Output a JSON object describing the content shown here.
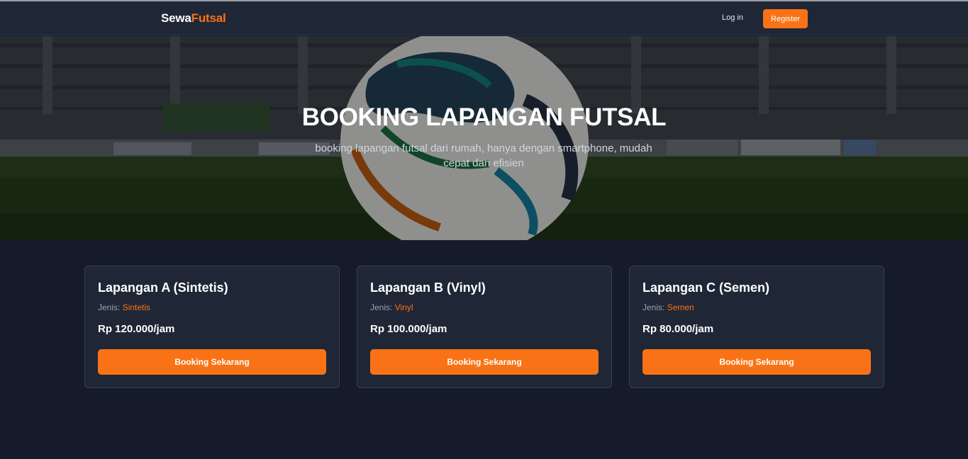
{
  "navbar": {
    "brand_part1": "Sewa",
    "brand_part2": "Futsal",
    "login_label": "Log in",
    "register_label": "Register"
  },
  "hero": {
    "title": "BOOKING LAPANGAN FUTSAL",
    "subtitle": "booking lapangan futsal dari rumah, hanya dengan smartphone, mudah cepat dan efisien"
  },
  "fields": [
    {
      "name": "Lapangan A (Sintetis)",
      "type_label": "Jenis:",
      "type_value": "Sintetis",
      "price": "Rp 120.000/jam",
      "button_label": "Booking Sekarang"
    },
    {
      "name": "Lapangan B (Vinyl)",
      "type_label": "Jenis:",
      "type_value": "Vinyl",
      "price": "Rp 100.000/jam",
      "button_label": "Booking Sekarang"
    },
    {
      "name": "Lapangan C (Semen)",
      "type_label": "Jenis:",
      "type_value": "Semen",
      "price": "Rp 80.000/jam",
      "button_label": "Booking Sekarang"
    }
  ],
  "colors": {
    "accent": "#f97316",
    "background": "#151b2b",
    "card": "#1f2737"
  }
}
